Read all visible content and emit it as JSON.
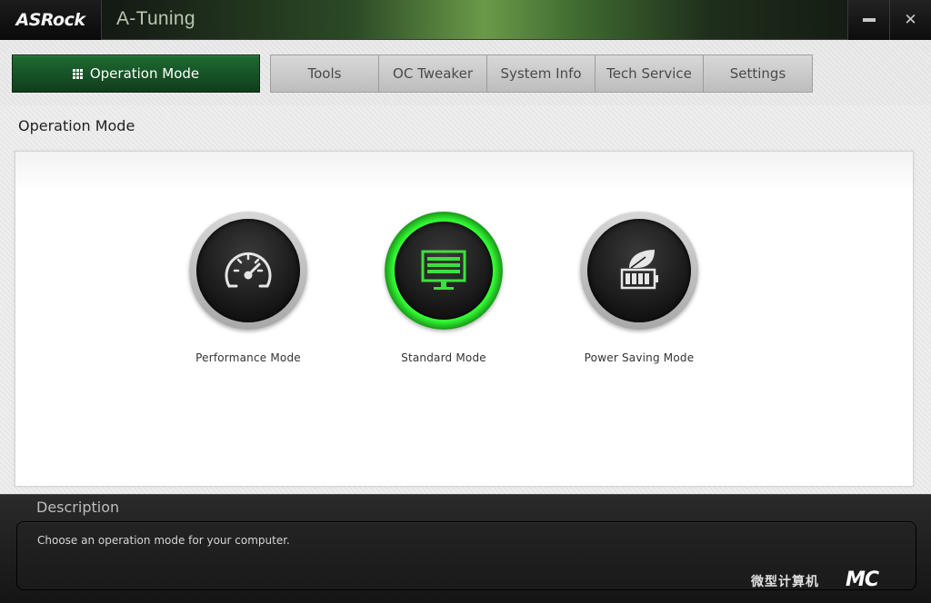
{
  "titlebar": {
    "logo": "ASRock",
    "app_title": "A-Tuning",
    "minimize_icon": "minimize-icon",
    "close_label": "✕"
  },
  "tabs": {
    "active": "Operation Mode",
    "items": [
      "Tools",
      "OC Tweaker",
      "System Info",
      "Tech Service",
      "Settings"
    ]
  },
  "section": {
    "title": "Operation Mode"
  },
  "modes": [
    {
      "label": "Performance Mode",
      "icon": "speedometer-icon",
      "active": false
    },
    {
      "label": "Standard Mode",
      "icon": "monitor-icon",
      "active": true
    },
    {
      "label": "Power Saving Mode",
      "icon": "leaf-battery-icon",
      "active": false
    }
  ],
  "description": {
    "title": "Description",
    "text": "Choose an operation mode for your computer."
  },
  "watermark": {
    "text": "微型计算机",
    "logo": "MC"
  },
  "colors": {
    "accent_green": "#1f6b32",
    "active_ring": "#34ff34"
  }
}
